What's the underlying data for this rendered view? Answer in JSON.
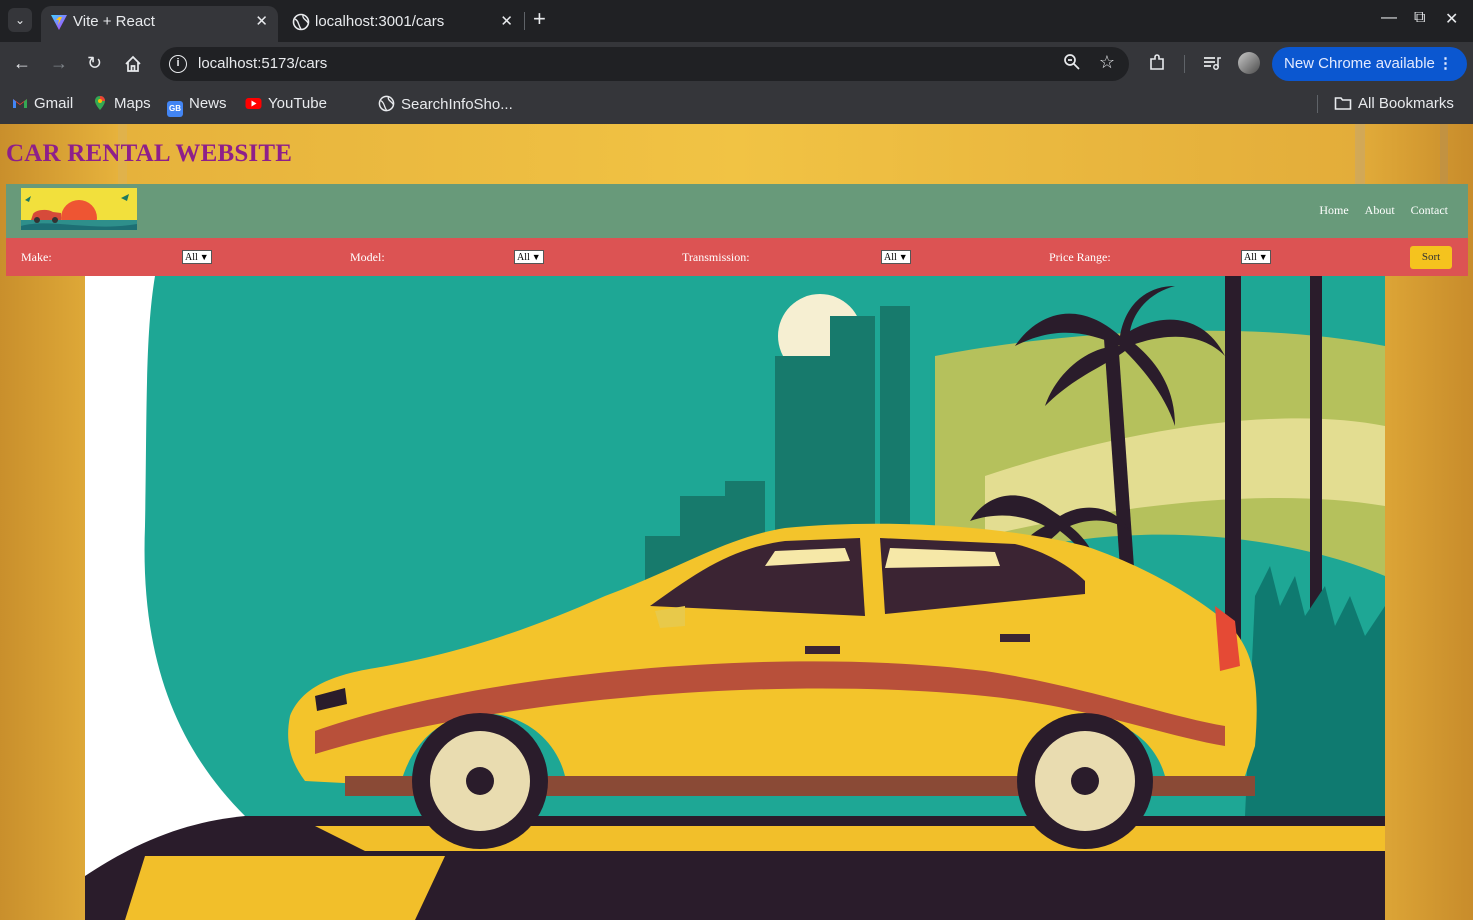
{
  "browser": {
    "tabs": [
      {
        "title": "Vite + React",
        "active": true
      },
      {
        "title": "localhost:3001/cars",
        "active": false
      }
    ],
    "url": "localhost:5173/cars",
    "update_button": "New Chrome available",
    "bookmarks": [
      "Gmail",
      "Maps",
      "News",
      "YouTube",
      "SearchInfoSho...",
      "All Bookmarks"
    ]
  },
  "page": {
    "title": "CAR RENTAL WEBSITE",
    "nav": [
      "Home",
      "About",
      "Contact"
    ],
    "filters": [
      {
        "label": "Make:",
        "value": "All"
      },
      {
        "label": "Model:",
        "value": "All"
      },
      {
        "label": "Transmission:",
        "value": "All"
      },
      {
        "label": "Price Range:",
        "value": "All"
      }
    ],
    "sort_label": "Sort"
  },
  "colors": {
    "title": "#8e1f8a",
    "navbar": "#689a7a",
    "filterbar": "#dc5353",
    "sort_button": "#f5c31e",
    "page_background": "#f1c344"
  },
  "icons": [
    "tab-search-icon",
    "vite-icon",
    "globe-icon",
    "close-icon",
    "plus-icon",
    "back-icon",
    "forward-icon",
    "reload-icon",
    "home-icon",
    "site-info-icon",
    "zoom-icon",
    "star-icon",
    "extensions-icon",
    "media-icon",
    "profile-icon",
    "kebab-icon",
    "folder-icon"
  ]
}
